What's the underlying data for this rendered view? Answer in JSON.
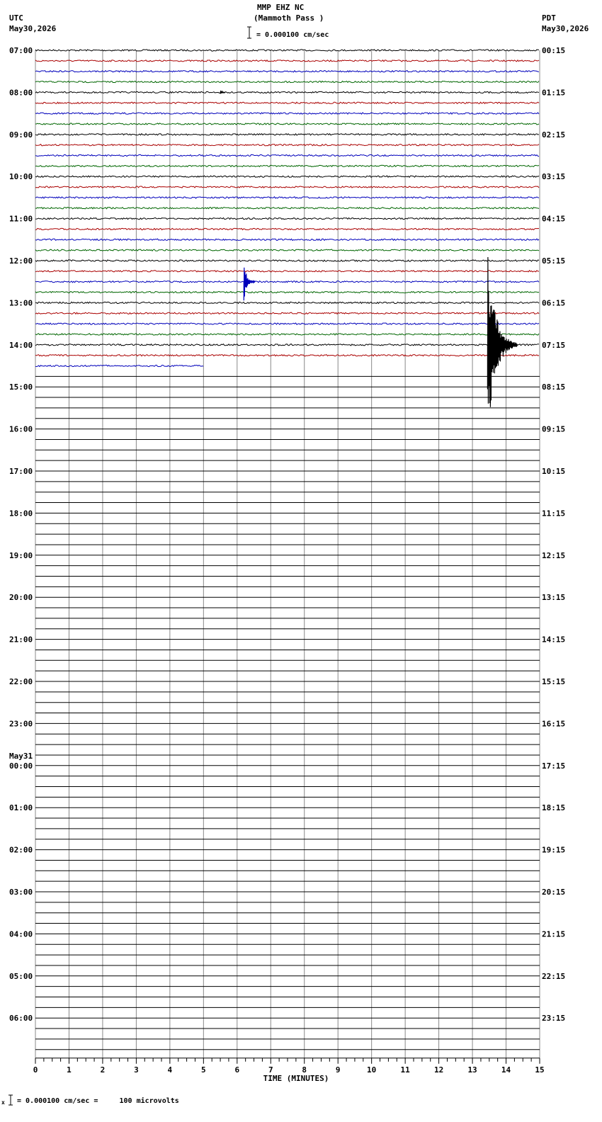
{
  "header": {
    "station": "MMP EHZ NC",
    "station_name": "(Mammoth Pass )",
    "scale_text": "= 0.000100 cm/sec",
    "left_zone": "UTC",
    "left_date": "May30,2026",
    "right_zone": "PDT",
    "right_date": "May30,2026"
  },
  "footer": {
    "prefix": "x",
    "scale_text": "= 0.000100 cm/sec =     100 microvolts"
  },
  "chart_data": {
    "type": "line",
    "title": "MMP EHZ NC (Mammoth Pass )",
    "xlabel": "TIME (MINUTES)",
    "xlim": [
      0,
      15
    ],
    "x_ticks": [
      "0",
      "1",
      "2",
      "3",
      "4",
      "5",
      "6",
      "7",
      "8",
      "9",
      "10",
      "11",
      "12",
      "13",
      "14",
      "15"
    ],
    "rows_total": 96,
    "row_minutes": 15,
    "left_hour_labels": [
      "07:00",
      "08:00",
      "09:00",
      "10:00",
      "11:00",
      "12:00",
      "13:00",
      "14:00",
      "15:00",
      "16:00",
      "17:00",
      "18:00",
      "19:00",
      "20:00",
      "21:00",
      "22:00",
      "23:00",
      "00:00",
      "01:00",
      "02:00",
      "03:00",
      "04:00",
      "05:00",
      "06:00"
    ],
    "date_change_label": "May31",
    "date_change_index": 17,
    "right_hour_labels": [
      "00:15",
      "01:15",
      "02:15",
      "03:15",
      "04:15",
      "05:15",
      "06:15",
      "07:15",
      "08:15",
      "09:15",
      "10:15",
      "11:15",
      "12:15",
      "13:15",
      "14:15",
      "15:15",
      "16:15",
      "17:15",
      "18:15",
      "19:15",
      "20:15",
      "21:15",
      "22:15",
      "23:15"
    ],
    "trace_colors": [
      "#000000",
      "#aa0000",
      "#0000bb",
      "#006600"
    ],
    "recorded_rows": 31,
    "last_row_end_minute": 5.0,
    "events": [
      {
        "row": 4,
        "minute": 5.5,
        "amplitude": 0.3,
        "decay": 0.15,
        "color": "#000000"
      },
      {
        "row": 22,
        "minute": 6.2,
        "amplitude": 1.8,
        "decay": 0.35,
        "color": "#0000bb"
      },
      {
        "row": 28,
        "minute": 13.45,
        "amplitude": 9.0,
        "decay": 0.9,
        "color": "#000000"
      }
    ]
  }
}
